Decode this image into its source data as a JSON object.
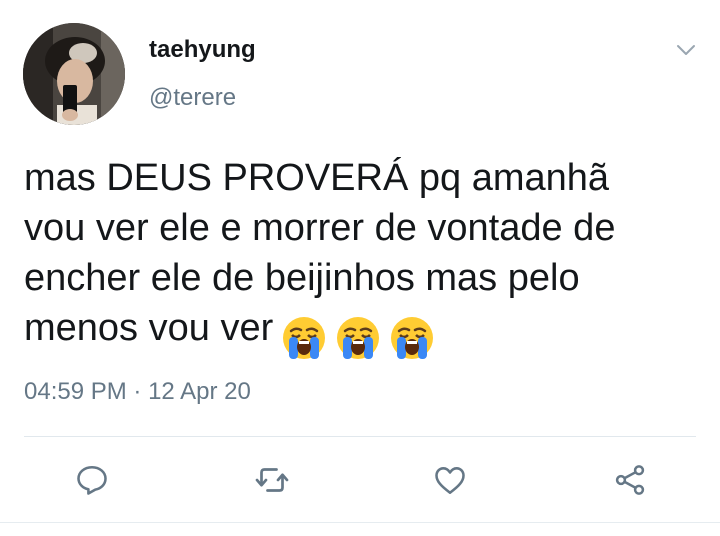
{
  "tweet": {
    "display_name": "taehyung",
    "handle": "@terere",
    "text_lines": [
      "mas DEUS PROVERÁ pq amanhã",
      "vou ver ele e morrer de vontade de",
      "encher ele de beijinhos mas pelo",
      "menos vou ver"
    ],
    "emojis": [
      "loudly-crying-face",
      "loudly-crying-face",
      "loudly-crying-face"
    ],
    "time": "04:59 PM",
    "separator": "·",
    "date": "12 Apr 20"
  },
  "icons": {
    "menu": "chevron-down-icon",
    "reply": "reply-icon",
    "retweet": "retweet-icon",
    "like": "heart-icon",
    "share": "share-icon"
  },
  "colors": {
    "text": "#14171a",
    "secondary": "#657786",
    "icon": "#657786",
    "divider": "#e1e8ed"
  }
}
